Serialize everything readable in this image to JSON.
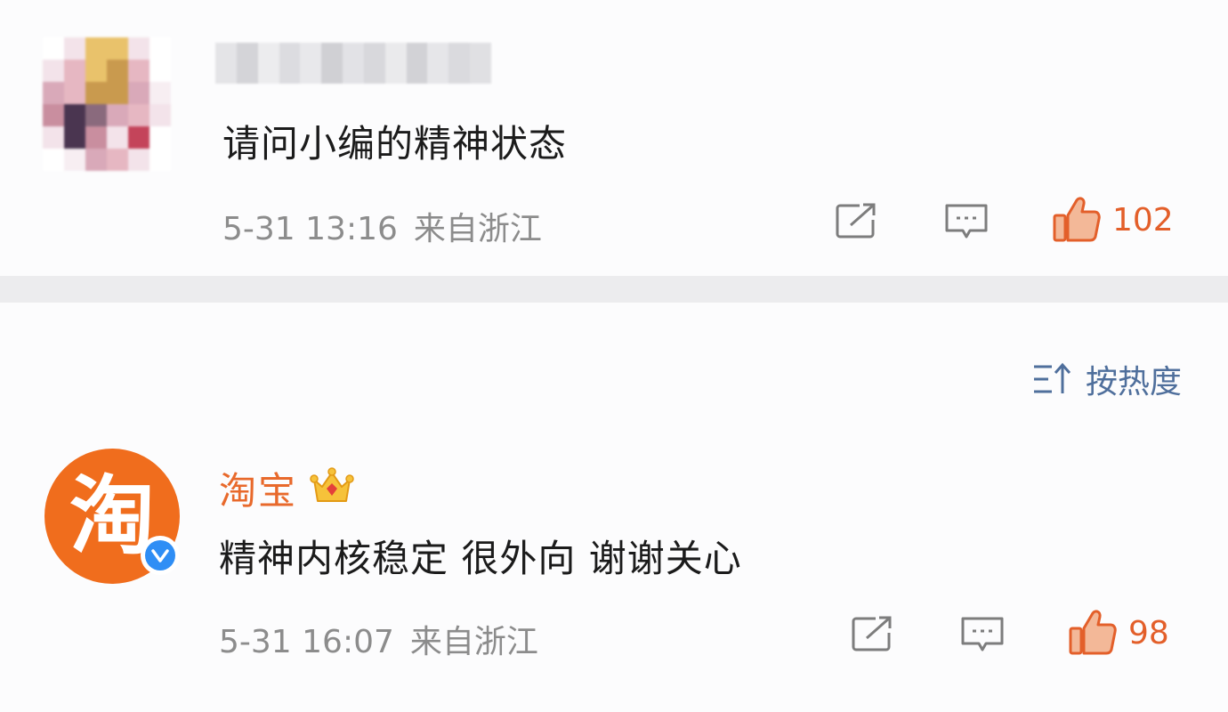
{
  "comments": [
    {
      "username_blurred": true,
      "text": "请问小编的精神状态",
      "time": "5-31 13:16",
      "location": "来自浙江",
      "likes": "102",
      "icons": [
        "share-icon",
        "comment-icon",
        "like-icon"
      ]
    },
    {
      "avatar_glyph": "淘",
      "username": "淘宝",
      "text": "精神内核稳定 很外向 谢谢关心",
      "time": "5-31 16:07",
      "location": "来自浙江",
      "likes": "98",
      "icons": [
        "crown-badge-icon",
        "verified-icon",
        "share-icon",
        "comment-icon",
        "like-icon"
      ]
    }
  ],
  "sort": {
    "label": "按热度",
    "icon": "sort-icon"
  },
  "colors": {
    "brand_orange": "#f06d1d",
    "username_orange": "#e8692b",
    "like_orange": "#e35f2a",
    "sort_blue": "#4f6f9c",
    "verified_blue": "#2f8ef5"
  }
}
